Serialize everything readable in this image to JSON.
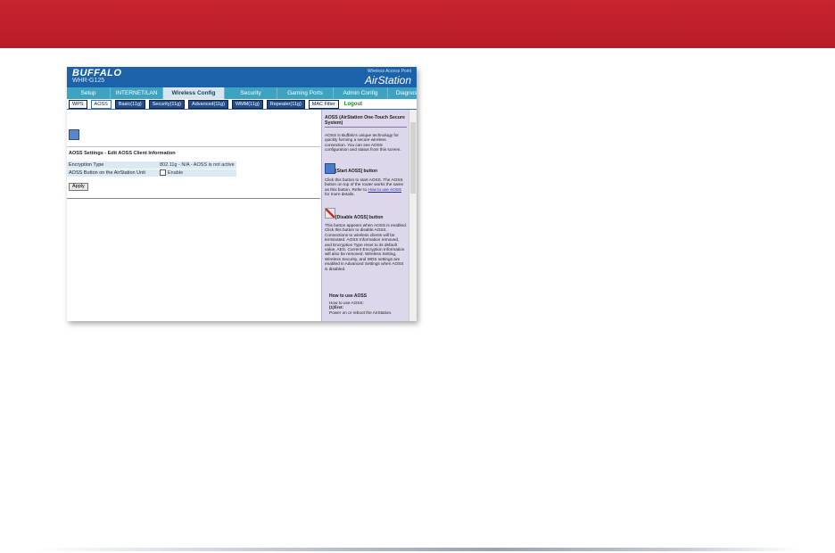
{
  "brand": "BUFFALO",
  "model": "WHR-G125",
  "ap_label": "Wireless Access Point",
  "product": "AirStation",
  "tabs": [
    "Setup",
    "INTERNET/LAN",
    "Wireless Config",
    "Security",
    "Gaming Ports",
    "Admin Config",
    "Diagnostic"
  ],
  "subtabs": [
    "WPS",
    "AOSS",
    "Basic(11g)",
    "Security(11g)",
    "Advanced(11g)",
    "WMM(11g)",
    "Repeater(11g)",
    "MAC Filter",
    "Logout"
  ],
  "section_title": "AOSS Settings - Edit AOSS Client Information",
  "rows": [
    {
      "label": "Encryption Type",
      "value": "802.11g - N/A - AOSS is not active"
    },
    {
      "label": "AOSS Button on the AirStation Unit",
      "value": "Enable"
    }
  ],
  "apply": "Apply",
  "help": {
    "title": "AOSS (AirStation One-Touch Secure System)",
    "intro": "AOSS is Buffalo's unique technology for quickly forming a secure wireless connection. You can see AOSS configuration and status from this screen.",
    "start_head": "[Start AOSS] button",
    "start_text_1": "Click this button to start AOSS. The AOSS button on top of the router works the same as this button. Refer to ",
    "start_link": "How to use AOSS",
    "start_text_2": " for more details.",
    "disable_head": "[Disable AOSS] button",
    "disable_text": "This button appears when AOSS is enabled. Click this button to disable AOSS. Connections to wireless clients will be terminated. AOSS Information removed, and Encryption Type reset to its default value, AES. Current Encryption Information will also be removed. Wireless Setting, Wireless Security, and WDS settings are enabled in Advanced Settings when AOSS is disabled.",
    "howto_head": "How to use AOSS",
    "howto_text": "How to use AOSS:",
    "howto_step": "(1)first:",
    "howto_step_text": "Power on or reboot the AirStation."
  }
}
